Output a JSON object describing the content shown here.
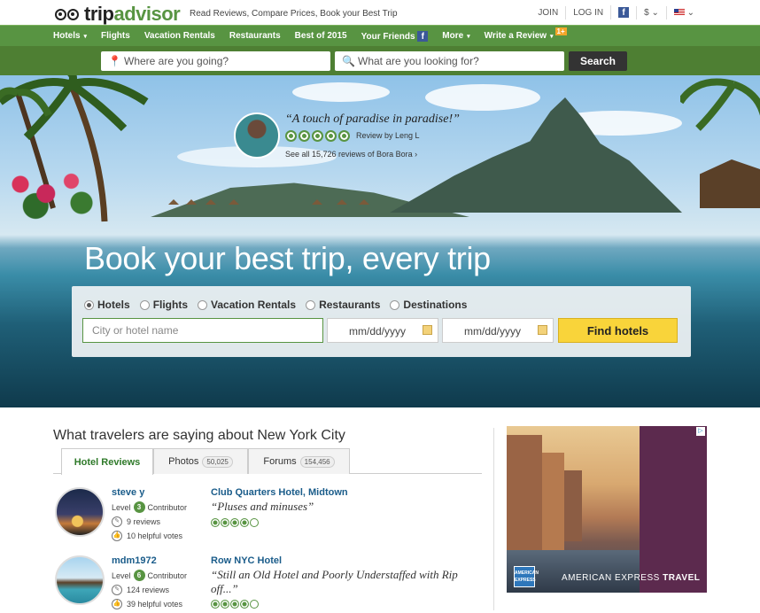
{
  "header": {
    "logo_text_a": "trip",
    "logo_text_b": "advisor",
    "tagline": "Read Reviews, Compare Prices, Book your Best Trip",
    "join": "JOIN",
    "login": "LOG IN",
    "currency": "$",
    "facebook_glyph": "f"
  },
  "nav": {
    "items": [
      "Hotels",
      "Flights",
      "Vacation Rentals",
      "Restaurants",
      "Best of 2015",
      "Your Friends",
      "More",
      "Write a Review"
    ],
    "review_badge": "1+"
  },
  "search": {
    "where_placeholder": "Where are you going?",
    "what_placeholder": "What are you looking for?",
    "button": "Search"
  },
  "hero": {
    "quote": "“A touch of paradise in paradise!”",
    "review_by": "Review by Leng L",
    "rating": 5,
    "see_all": "See all 15,726 reviews of Bora Bora",
    "title": "Book your best trip, every trip"
  },
  "finder": {
    "options": [
      "Hotels",
      "Flights",
      "Vacation Rentals",
      "Restaurants",
      "Destinations"
    ],
    "selected": "Hotels",
    "city_placeholder": "City or hotel name",
    "checkin_placeholder": "mm/dd/yyyy",
    "checkout_placeholder": "mm/dd/yyyy",
    "button": "Find hotels"
  },
  "reviews_section": {
    "title": "What travelers are saying about New York City",
    "tabs": [
      {
        "label": "Hotel Reviews",
        "count": ""
      },
      {
        "label": "Photos",
        "count": "50,025"
      },
      {
        "label": "Forums",
        "count": "154,456"
      }
    ],
    "reviews": [
      {
        "user": "steve y",
        "level_prefix": "Level",
        "level": "3",
        "level_suffix": "Contributor",
        "reviews": "9 reviews",
        "helpful": "10 helpful votes",
        "hotel": "Club Quarters Hotel, Midtown",
        "quote": "“Pluses and minuses”",
        "rating": 4
      },
      {
        "user": "mdm1972",
        "level_prefix": "Level",
        "level": "6",
        "level_suffix": "Contributor",
        "reviews": "124 reviews",
        "helpful": "39 helpful votes",
        "hotel": "Row NYC Hotel",
        "quote": "“Still an Old Hotel and Poorly Understaffed with Rip off...”",
        "rating": 4
      }
    ]
  },
  "ad": {
    "brand_text_light": "AMERICAN EXPRESS",
    "brand_text_bold": "TRAVEL",
    "logo_text": "AMERICAN EXPRESS"
  },
  "colors": {
    "brand_green": "#589442",
    "search_green": "#4e7f33",
    "link_blue": "#1a5c8a",
    "find_button_yellow": "#f9d43a"
  }
}
